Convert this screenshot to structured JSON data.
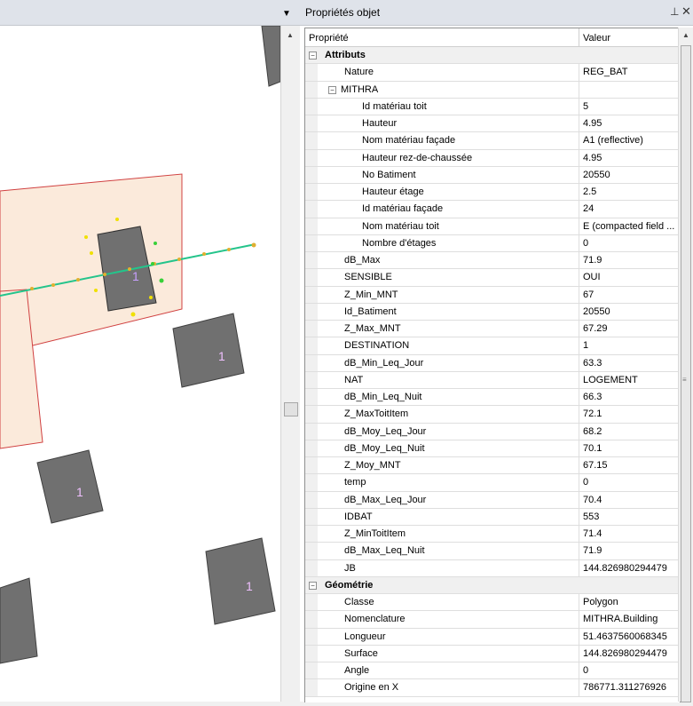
{
  "map": {
    "building_label": "1",
    "dropdown_icon": "chevron-down-icon",
    "colors": {
      "building": "#707070",
      "zone_fill": "#fbeadb",
      "zone_stroke": "#d04040",
      "profile_line": "#24c48b",
      "receiver_yellow": "#f0e000",
      "receiver_green": "#38d038"
    }
  },
  "panel": {
    "title": "Propriétés objet",
    "pin_icon": "pin-icon",
    "close_icon": "close-icon",
    "col_property": "Propriété",
    "col_value": "Valeur"
  },
  "rows": [
    {
      "label": "Attributs",
      "value": "",
      "category": true
    },
    {
      "label": "Nature",
      "value": "REG_BAT"
    },
    {
      "label": "MITHRA",
      "value": "",
      "group": true
    },
    {
      "label": "Id matériau toit",
      "value": "5",
      "sub": true
    },
    {
      "label": "Hauteur",
      "value": "4.95",
      "sub": true
    },
    {
      "label": "Nom matériau façade",
      "value": "A1 (reflective)",
      "sub": true
    },
    {
      "label": "Hauteur rez-de-chaussée",
      "value": "4.95",
      "sub": true
    },
    {
      "label": "No Batiment",
      "value": "20550",
      "sub": true
    },
    {
      "label": "Hauteur étage",
      "value": "2.5",
      "sub": true
    },
    {
      "label": "Id matériau façade",
      "value": "24",
      "sub": true
    },
    {
      "label": "Nom matériau toit",
      "value": "E (compacted field ...",
      "sub": true
    },
    {
      "label": "Nombre d'étages",
      "value": "0",
      "sub": true
    },
    {
      "label": "dB_Max",
      "value": "71.9"
    },
    {
      "label": "SENSIBLE",
      "value": "OUI"
    },
    {
      "label": "Z_Min_MNT",
      "value": "67"
    },
    {
      "label": "Id_Batiment",
      "value": "20550"
    },
    {
      "label": "Z_Max_MNT",
      "value": "67.29"
    },
    {
      "label": "DESTINATION",
      "value": "1"
    },
    {
      "label": "dB_Min_Leq_Jour",
      "value": "63.3"
    },
    {
      "label": "NAT",
      "value": "LOGEMENT"
    },
    {
      "label": "dB_Min_Leq_Nuit",
      "value": "66.3"
    },
    {
      "label": "Z_MaxToitItem",
      "value": "72.1"
    },
    {
      "label": "dB_Moy_Leq_Jour",
      "value": "68.2"
    },
    {
      "label": "dB_Moy_Leq_Nuit",
      "value": "70.1"
    },
    {
      "label": "Z_Moy_MNT",
      "value": "67.15"
    },
    {
      "label": "temp",
      "value": "0"
    },
    {
      "label": "dB_Max_Leq_Jour",
      "value": "70.4"
    },
    {
      "label": "IDBAT",
      "value": "553"
    },
    {
      "label": "Z_MinToitItem",
      "value": "71.4"
    },
    {
      "label": "dB_Max_Leq_Nuit",
      "value": "71.9"
    },
    {
      "label": "JB",
      "value": "144.826980294479"
    },
    {
      "label": "Géométrie",
      "value": "",
      "category": true
    },
    {
      "label": "Classe",
      "value": "Polygon"
    },
    {
      "label": "Nomenclature",
      "value": "MITHRA.Building"
    },
    {
      "label": "Longueur",
      "value": "51.4637560068345"
    },
    {
      "label": "Surface",
      "value": "144.826980294479"
    },
    {
      "label": "Angle",
      "value": "0"
    },
    {
      "label": "Origine en X",
      "value": "786771.311276926"
    }
  ]
}
